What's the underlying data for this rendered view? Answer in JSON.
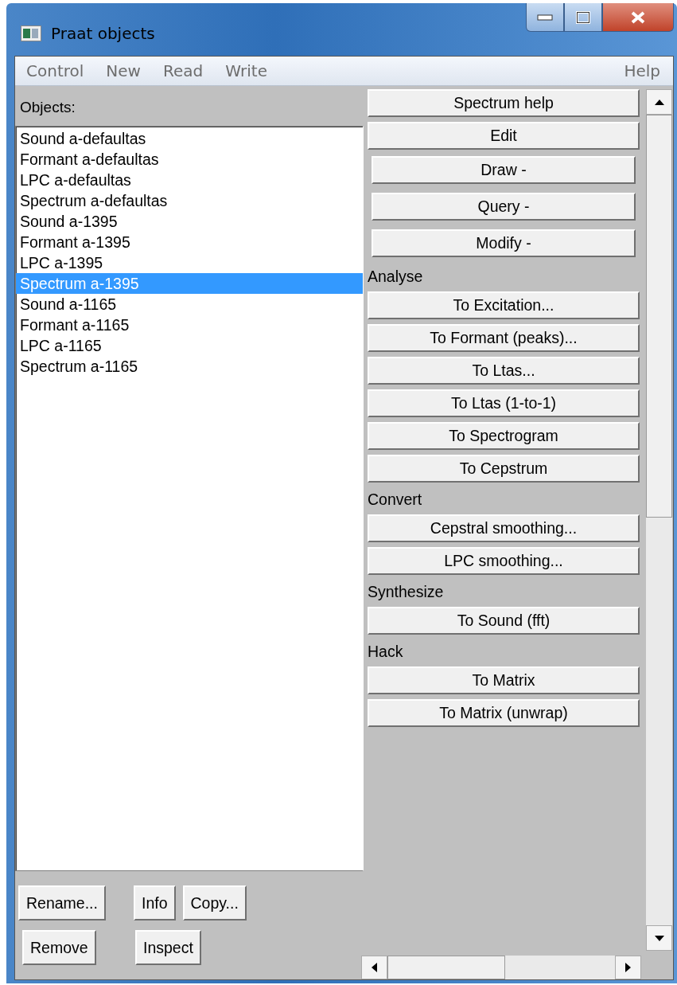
{
  "window": {
    "title": "Praat objects"
  },
  "menu": [
    {
      "label": "Control"
    },
    {
      "label": "New"
    },
    {
      "label": "Read"
    },
    {
      "label": "Write"
    }
  ],
  "help_menu": {
    "label": "Help"
  },
  "objects": {
    "label": "Objects:",
    "items": [
      {
        "name": "Sound a-defaultas",
        "selected": false
      },
      {
        "name": "Formant a-defaultas",
        "selected": false
      },
      {
        "name": "LPC a-defaultas",
        "selected": false
      },
      {
        "name": "Spectrum a-defaultas",
        "selected": false
      },
      {
        "name": "Sound a-1395",
        "selected": false
      },
      {
        "name": "Formant a-1395",
        "selected": false
      },
      {
        "name": "LPC a-1395",
        "selected": false
      },
      {
        "name": "Spectrum a-1395",
        "selected": true
      },
      {
        "name": "Sound a-1165",
        "selected": false
      },
      {
        "name": "Formant a-1165",
        "selected": false
      },
      {
        "name": "LPC a-1165",
        "selected": false
      },
      {
        "name": "Spectrum a-1165",
        "selected": false
      }
    ]
  },
  "bottom_buttons": [
    {
      "left": [
        "Rename..."
      ],
      "right": [
        "Info",
        "Copy..."
      ]
    },
    {
      "left": [
        "Remove"
      ],
      "right": [
        "Inspect"
      ]
    }
  ],
  "actions": [
    {
      "kind": "button",
      "label": "Spectrum help"
    },
    {
      "kind": "button",
      "label": "Edit"
    },
    {
      "kind": "submenu",
      "label": "Draw -"
    },
    {
      "kind": "submenu",
      "label": "Query -"
    },
    {
      "kind": "submenu",
      "label": "Modify -"
    },
    {
      "kind": "header",
      "label": "Analyse"
    },
    {
      "kind": "button",
      "label": "To Excitation..."
    },
    {
      "kind": "button",
      "label": "To Formant (peaks)..."
    },
    {
      "kind": "button",
      "label": "To Ltas..."
    },
    {
      "kind": "button",
      "label": "To Ltas (1-to-1)"
    },
    {
      "kind": "button",
      "label": "To Spectrogram"
    },
    {
      "kind": "button",
      "label": "To Cepstrum"
    },
    {
      "kind": "header",
      "label": "Convert"
    },
    {
      "kind": "button",
      "label": "Cepstral smoothing..."
    },
    {
      "kind": "button",
      "label": "LPC smoothing..."
    },
    {
      "kind": "header",
      "label": "Synthesize"
    },
    {
      "kind": "button",
      "label": "To Sound (fft)"
    },
    {
      "kind": "header",
      "label": "Hack"
    },
    {
      "kind": "button",
      "label": "To Matrix"
    },
    {
      "kind": "button",
      "label": "To Matrix (unwrap)"
    }
  ]
}
